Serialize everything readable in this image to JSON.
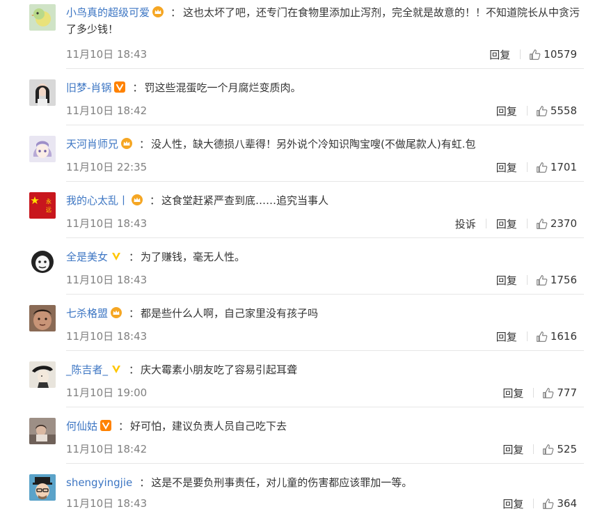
{
  "labels": {
    "reply": "回复",
    "report": "投诉"
  },
  "colors": {
    "username": "#3d76c3",
    "vip_crown": "#f5a623",
    "verified_orange": "#ff8200",
    "verified_yellow": "#ffc600",
    "time": "#808080",
    "text": "#333333"
  },
  "comments": [
    {
      "username": "小鸟真的超级可爱",
      "badge": "vip-crown-icon",
      "text": "这也太坏了吧，还专门在食物里添加止泻剂，完全就是故意的！！不知道院长从中贪污了多少钱！",
      "time": "11月10日 18:43",
      "likes": "10579",
      "avatar": "bird-avatar"
    },
    {
      "username": "旧梦-肖锅",
      "badge": "verified-orange-icon",
      "text": "罚这些混蛋吃一个月腐烂变质肉。",
      "time": "11月10日 18:42",
      "likes": "5558",
      "avatar": "portrait-avatar"
    },
    {
      "username": "天河肖师兄",
      "badge": "vip-crown-icon",
      "text": "没人性，缺大德损八辈得！另外说个冷知识陶宝嗖(不做尾款人)有虹.包",
      "time": "11月10日 22:35",
      "likes": "1701",
      "avatar": "anime-avatar"
    },
    {
      "username": "我的心太乱丨",
      "badge": "vip-crown-icon",
      "text": "这食堂赶紧严查到底……追究当事人",
      "time": "11月10日 18:43",
      "likes": "2370",
      "avatar": "flag-avatar",
      "show_report": true
    },
    {
      "username": "全是美女",
      "badge": "verified-yellow-icon",
      "text": "为了赚钱，毫无人性。",
      "time": "11月10日 18:43",
      "likes": "1756",
      "avatar": "meme-avatar"
    },
    {
      "username": "七杀格盟",
      "badge": "vip-crown-icon",
      "text": "都是些什么人啊，自己家里没有孩子吗",
      "time": "11月10日 18:43",
      "likes": "1616",
      "avatar": "face-avatar"
    },
    {
      "username": "_陈吉者_",
      "badge": "verified-yellow-icon",
      "text": "庆大霉素小朋友吃了容易引起耳聋",
      "time": "11月10日 19:00",
      "likes": "777",
      "avatar": "sketch-avatar"
    },
    {
      "username": "何仙姑",
      "badge": "verified-orange-icon",
      "text": "好可怕，建议负责人员自己吃下去",
      "time": "11月10日 18:42",
      "likes": "525",
      "avatar": "photo-avatar"
    },
    {
      "username": "shengyingjie",
      "badge": "",
      "text": "这是不是要负刑事责任，对儿童的伤害都应该罪加一等。",
      "time": "11月10日 18:43",
      "likes": "364",
      "avatar": "cartoon-man-avatar"
    }
  ]
}
